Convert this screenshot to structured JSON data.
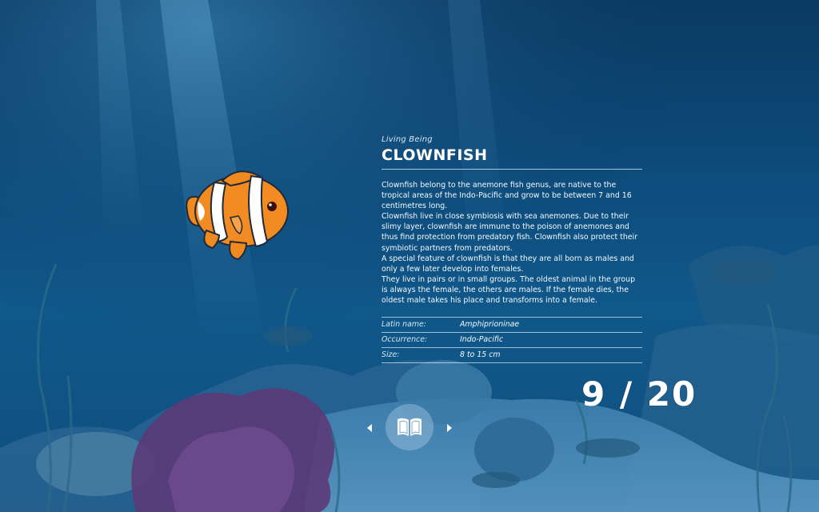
{
  "panel": {
    "category": "Living Being",
    "title": "CLOWNFISH",
    "description": [
      "Clownfish belong to the anemone fish genus, are native to the tropical areas of the Indo-Pacific and grow to be between 7 and 16 centimetres long.",
      "Clownfish live in close symbiosis with sea anemones. Due to their slimy layer, clownfish are immune to the poison of anemones and thus find protection from predatory fish. Clownfish also protect their symbiotic partners from predators.",
      "A special feature of clownfish is that they are all born as males and only a few later develop into females.",
      "They live in pairs or in small groups. The oldest animal in the group is always the female, the others are males. If the female dies, the oldest male takes his place and transforms into a female."
    ],
    "facts": [
      {
        "label": "Latin name:",
        "value": "Amphiprioninae"
      },
      {
        "label": "Occurrence:",
        "value": "Indo-Pacific"
      },
      {
        "label": "Size:",
        "value": "8 to 15 cm"
      }
    ]
  },
  "counter": "9 / 20",
  "progress": {
    "current": 9,
    "total": 20
  },
  "icons": {
    "prev": "chevron-left-icon",
    "next": "chevron-right-icon",
    "book": "book-icon"
  },
  "colors": {
    "water_dark": "#0a3a63",
    "water_light": "#10588a",
    "fish_orange": "#f08a1e",
    "coral_purple": "#5b3a78"
  }
}
